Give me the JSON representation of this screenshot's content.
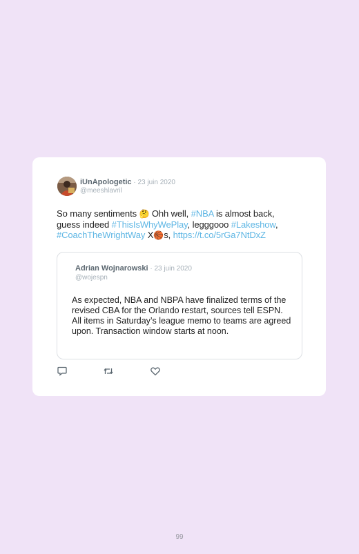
{
  "tweet": {
    "author_name": "iUnApologetic",
    "separator": " · ",
    "date": "23 juin 2020",
    "handle": "@meeshlavril",
    "text_parts": {
      "t1": "So many sentiments ",
      "emoji_think": "🤔",
      "t2": " Ohh well, ",
      "tag_nba": "#NBA",
      "t3": " is almost back, guess indeed ",
      "tag_why": "#ThisIsWhyWePlay",
      "t4": ", legggooo ",
      "tag_lakeshow": "#Lakeshow",
      "t5": ", ",
      "tag_coach": "#CoachTheWrightWay",
      "t6": " X",
      "emoji_ball": "🏀",
      "t7": "s, ",
      "url": "https://t.co/5rGa7NtDxZ"
    }
  },
  "quoted": {
    "author_name": "Adrian Wojnarowski",
    "separator": " · ",
    "date": "23 juin 2020",
    "handle": "@wojespn",
    "text": "As expected, NBA and NBPA have finalized terms of the revised CBA for the Orlando restart, sources tell ESPN. All items in Saturday’s league memo to teams are agreed upon. Transaction window starts at noon."
  },
  "actions": {
    "reply_icon": "reply-icon",
    "retweet_icon": "retweet-icon",
    "like_icon": "heart-icon"
  },
  "page_number": "99",
  "colors": {
    "background": "#f0e3f7",
    "link": "#5eb6e4",
    "muted": "#a6b0b8"
  }
}
